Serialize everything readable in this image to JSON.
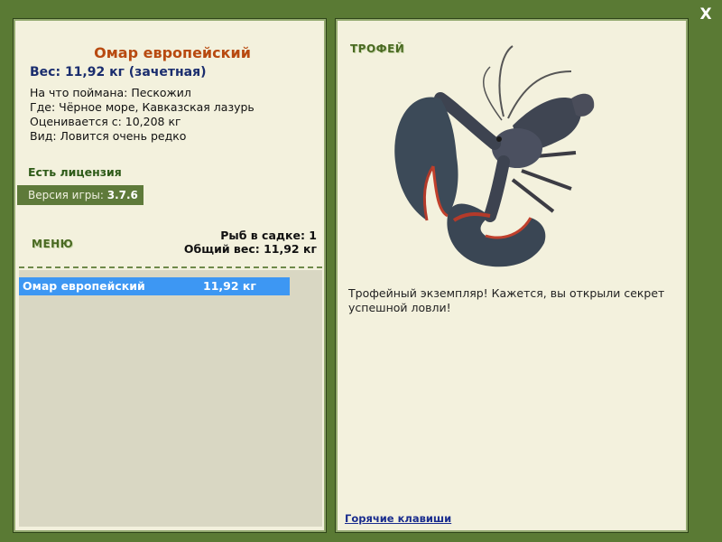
{
  "close_label": "X",
  "fish": {
    "name": "Омар европейский",
    "weight_line": "Вес: 11,92 кг (зачетная)",
    "caught_on": "На что поймана: Пескожил",
    "where": "Где: Чёрное море, Кавказская лазурь",
    "rated_from": "Оценивается с: 10,208 кг",
    "kind": "Вид: Ловится очень редко"
  },
  "license": "Есть лицензия",
  "version": {
    "label": "Версия игры:",
    "value": "3.7.6"
  },
  "menu_label": "МЕНЮ",
  "stats": {
    "fish_in_keepnet": "Рыб в садке: 1",
    "total_weight": "Общий вес: 11,92 кг"
  },
  "catch_list": [
    {
      "name": "Омар европейский",
      "weight": "11,92 кг"
    }
  ],
  "trophy": {
    "title": "ТРОФЕЙ",
    "description": "Трофейный экземпляр! Кажется, вы открыли секрет успешной ловли!"
  },
  "hotkeys_link": "Горячие клавиши",
  "colors": {
    "background": "#5a7a34",
    "panel": "#f3f1dd",
    "selection": "#3d97f3",
    "fish_name": "#b84a10"
  }
}
